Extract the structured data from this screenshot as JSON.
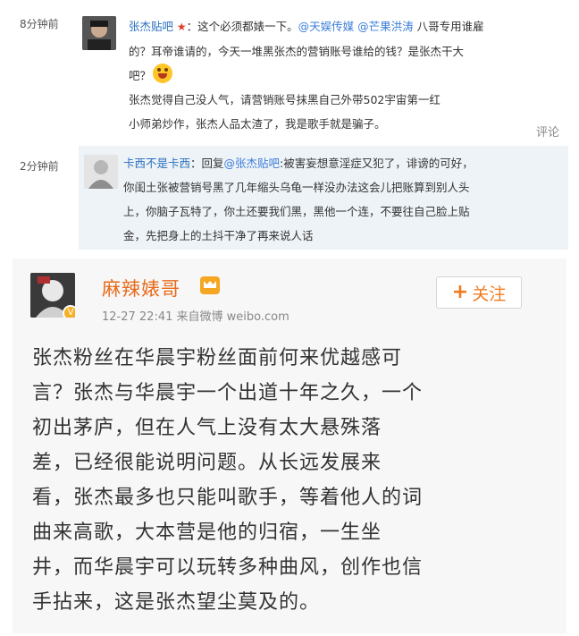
{
  "comments": [
    {
      "time": "8分钟前",
      "user": "张杰贴吧",
      "lines": [
        {
          "segments": [
            {
              "text": "张杰贴吧",
              "kind": "uname"
            },
            {
              "text": " ★",
              "kind": "star"
            },
            {
              "text": "：这个必须都婊一下。",
              "kind": "text"
            },
            {
              "text": "@天娱传媒",
              "kind": "mention"
            },
            {
              "text": " ",
              "kind": "text"
            },
            {
              "text": "@芒果洪涛",
              "kind": "mention"
            },
            {
              "text": " 八哥专用谁雇",
              "kind": "text"
            }
          ]
        },
        {
          "segments": [
            {
              "text": "的？耳帝谁请的，今天一堆黑张杰的营销账号谁给的钱？是张杰干大",
              "kind": "text"
            }
          ]
        },
        {
          "segments": [
            {
              "text": "吧？",
              "kind": "text"
            },
            {
              "text": "",
              "kind": "emoji"
            }
          ]
        },
        {
          "segments": [
            {
              "text": "张杰觉得自己没人气，请营销账号抹黑自己外带502宇宙第一红",
              "kind": "text"
            }
          ]
        },
        {
          "segments": [
            {
              "text": "小师弟炒作，张杰人品太渣了，我是歌手就是骗子。",
              "kind": "text"
            }
          ]
        }
      ],
      "action": "评论"
    },
    {
      "time": "2分钟前",
      "user": "卡西不是卡西",
      "lines": [
        {
          "segments": [
            {
              "text": "卡西不是卡西",
              "kind": "uname"
            },
            {
              "text": "：回复",
              "kind": "text"
            },
            {
              "text": "@张杰贴吧",
              "kind": "mention"
            },
            {
              "text": ":被害妄想意淫症又犯了，诽谤的可好，",
              "kind": "text"
            }
          ]
        },
        {
          "segments": [
            {
              "text": "你闺土张被营销号黑了几年缩头乌龟一样没办法这会儿把账算到别人头",
              "kind": "text"
            }
          ]
        },
        {
          "segments": [
            {
              "text": "上，你脑子瓦特了，你土还要我们黑，黑他一个连，不要往自己脸上贴",
              "kind": "text"
            }
          ]
        },
        {
          "segments": [
            {
              "text": "金，先把身上的土抖干净了再来说人话",
              "kind": "text"
            }
          ]
        }
      ]
    }
  ],
  "post": {
    "author": "麻辣婊哥",
    "meta": "12-27 22:41  来自微博 weibo.com",
    "follow_label": "关注",
    "body_lines": [
      "张杰粉丝在华晨宇粉丝面前何来优越感可",
      "言？张杰与华晨宇一个出道十年之久，一个",
      "初出茅庐，但在人气上没有太大悬殊落",
      "差，已经很能说明问题。从长远发展来",
      "看，张杰最多也只能叫歌手，等着他人的词",
      "曲来高歌，大本营是他的归宿，一生坐",
      "井，而华晨宇可以玩转多种曲风，创作也信",
      "手拈来，这是张杰望尘莫及的。"
    ]
  },
  "colors": {
    "username": "#2a6fbf",
    "mention": "#3b7dd8",
    "author": "#e86b1c",
    "follow": "#f07b1f"
  },
  "icons": [
    "star-icon",
    "laughing-emoji-icon",
    "verified-badge-icon",
    "crown-icon",
    "plus-icon"
  ]
}
